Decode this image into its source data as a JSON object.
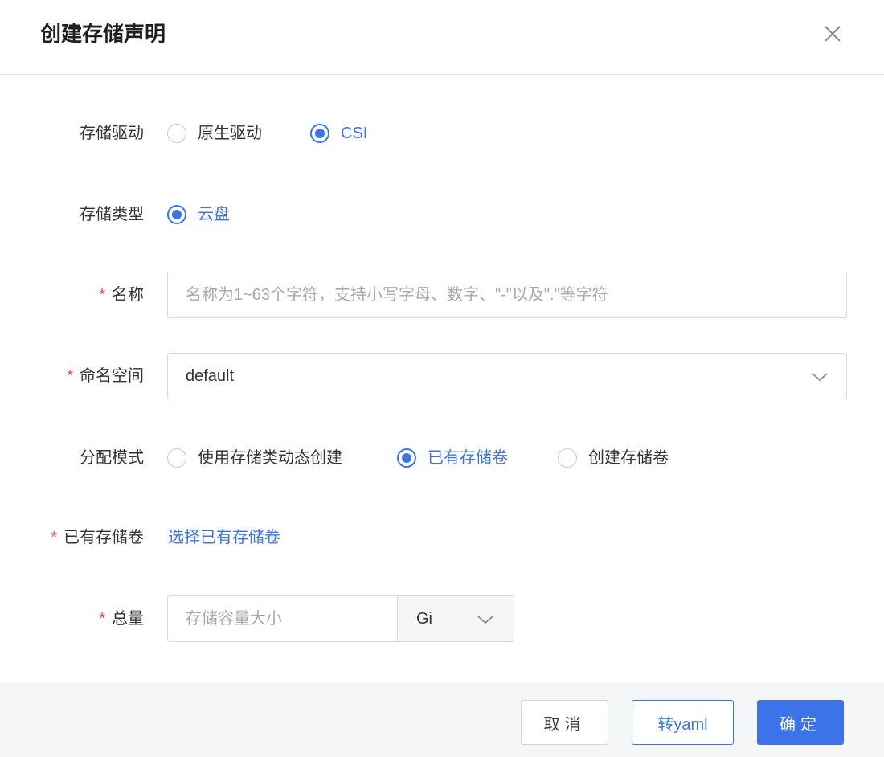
{
  "dialog": {
    "title": "创建存储声明"
  },
  "form": {
    "storage_driver": {
      "label": "存储驱动",
      "options": [
        {
          "label": "原生驱动",
          "checked": false
        },
        {
          "label": "CSI",
          "checked": true
        }
      ]
    },
    "storage_type": {
      "label": "存储类型",
      "options": [
        {
          "label": "云盘",
          "checked": true
        }
      ]
    },
    "name": {
      "required_mark": "*",
      "label": "名称",
      "value": "",
      "placeholder": "名称为1~63个字符，支持小写字母、数字、\"-\"以及\".\"等字符"
    },
    "namespace": {
      "required_mark": "*",
      "label": "命名空间",
      "value": "default"
    },
    "allocation_mode": {
      "label": "分配模式",
      "options": [
        {
          "label": "使用存储类动态创建",
          "checked": false
        },
        {
          "label": "已有存储卷",
          "checked": true
        },
        {
          "label": "创建存储卷",
          "checked": false
        }
      ]
    },
    "existing_volume": {
      "required_mark": "*",
      "label": "已有存储卷",
      "link": "选择已有存储卷"
    },
    "capacity": {
      "required_mark": "*",
      "label": "总量",
      "value": "",
      "placeholder": "存储容量大小",
      "unit": "Gi"
    }
  },
  "footer": {
    "cancel_label": "取消",
    "yaml_label": "转yaml",
    "ok_label": "确定"
  },
  "colors": {
    "accent": "#3b73e8",
    "required": "#e5484d",
    "footer_bg": "#f5f6f7"
  },
  "icons": {
    "close": "close-icon",
    "select_arrow": "chevron-down-icon"
  }
}
